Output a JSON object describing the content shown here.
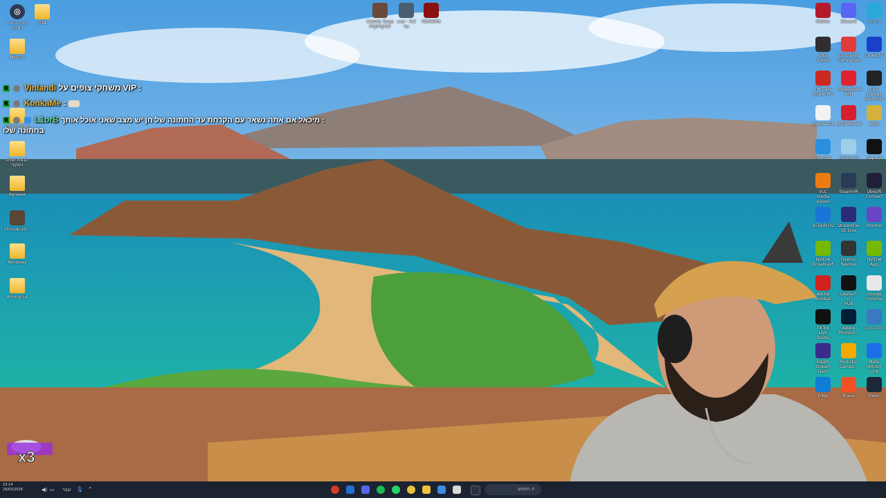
{
  "desktop_left_icons": [
    {
      "label": "קבל פרטים\nו מדוף",
      "icon": "circle-icon"
    },
    {
      "label": "GTA",
      "icon": "folder-icon"
    },
    {
      "label": "PHOTO",
      "icon": "folder-icon"
    },
    {
      "label": "DSWindows",
      "icon": "folder-icon"
    },
    {
      "label": "קבצות שונים\nבשקוף",
      "icon": "folder-icon"
    },
    {
      "label": "Agreeee",
      "icon": "folder-icon"
    },
    {
      "label": "vlcsnap-20...",
      "icon": "image-icon"
    },
    {
      "label": "Windows",
      "icon": "folder-icon"
    },
    {
      "label": "Among Us",
      "icon": "folder-icon"
    }
  ],
  "desktop_top_icons": [
    {
      "label": "Cosmic Soup\nHighlightS",
      "icon": "person-icon"
    },
    {
      "label": "קובץ - fc2\nנוף",
      "icon": "image-icon"
    },
    {
      "label": "REANIMA",
      "icon": "game-icon"
    }
  ],
  "desktop_right_icons": [
    {
      "label": "Roblox",
      "icon": "roblox-icon",
      "color": "#b51a2a"
    },
    {
      "label": "Discord",
      "icon": "discord-icon",
      "color": "#5865f2"
    },
    {
      "label": "וח רוסר",
      "icon": "monitor-icon",
      "color": "#2aa9d8"
    },
    {
      "label": "OBS Studio",
      "icon": "obs-icon",
      "color": "#302e31"
    },
    {
      "label": "Controller\nCompanion",
      "icon": "controller-icon",
      "color": "#e23b3b"
    },
    {
      "label": "CorelySC",
      "icon": "app-icon",
      "color": "#1a40c9"
    },
    {
      "label": "FM Cars\nStreet Pro",
      "icon": "car-icon",
      "color": "#cc2a20"
    },
    {
      "label": "Bitdefender\nVPN",
      "icon": "shield-icon",
      "color": "#e0232f"
    },
    {
      "label": "Epic Games\nLauncher",
      "icon": "epic-icon",
      "color": "#222"
    },
    {
      "label": "Overwatch",
      "icon": "overwatch-icon",
      "color": "#f2f2f2"
    },
    {
      "label": "Bitdefender",
      "icon": "bitdefender-icon",
      "color": "#d4202c"
    },
    {
      "label": "Bully",
      "icon": "bully-icon",
      "color": "#d4b13a"
    },
    {
      "label": "Fortnite",
      "icon": "fortnite-icon",
      "color": "#2b8fe0"
    },
    {
      "label": "סל המיחזור",
      "icon": "recycle-bin-icon",
      "color": "#9ecfe8"
    },
    {
      "label": "CapCut",
      "icon": "capcut-icon",
      "color": "#111"
    },
    {
      "label": "VLC media\nplayer",
      "icon": "vlc-icon",
      "color": "#f07a12"
    },
    {
      "label": "SteamVR",
      "icon": "vr-icon",
      "color": "#2a3b56"
    },
    {
      "label": "Ubisoft\nConnect",
      "icon": "ubisoft-icon",
      "color": "#1f1f3a"
    },
    {
      "label": "3uTools(32...",
      "icon": "tools-icon",
      "color": "#1b75d8"
    },
    {
      "label": "StreamEle...\nSE.Live",
      "icon": "streamelements-icon",
      "color": "#2b2b7a"
    },
    {
      "label": "Stremio",
      "icon": "stremio-icon",
      "color": "#6c45c7"
    },
    {
      "label": "NVIDIA\nBroadcast",
      "icon": "nvidia-icon",
      "color": "#76b900"
    },
    {
      "label": "DaVinci\nResolve",
      "icon": "davinci-icon",
      "color": "#333"
    },
    {
      "label": "NVIDIA App",
      "icon": "nvidia-icon",
      "color": "#76b900"
    },
    {
      "label": "Adobe\nAcrobat",
      "icon": "acrobat-icon",
      "color": "#d0211c"
    },
    {
      "label": "Logitech G\nHUB",
      "icon": "logitech-icon",
      "color": "#111"
    },
    {
      "label": "Google\nChrome",
      "icon": "chrome-icon",
      "color": "#e8e8e8"
    },
    {
      "label": "TikTok LIVE\nStudio",
      "icon": "tiktok-icon",
      "color": "#111"
    },
    {
      "label": "Adobe\nPhotosh...",
      "icon": "photoshop-icon",
      "color": "#001e36"
    },
    {
      "label": "לוח הבקרה",
      "icon": "control-panel-icon",
      "color": "#3a78c2"
    },
    {
      "label": "Elgato\nStream Deck",
      "icon": "streamdeck-icon",
      "color": "#3c2b8a"
    },
    {
      "label": "Rockstar\nGames...",
      "icon": "rockstar-icon",
      "color": "#f2a900"
    },
    {
      "label": "Meta\nHorizon Link",
      "icon": "meta-icon",
      "color": "#1c6fe8"
    },
    {
      "label": "Edge",
      "icon": "edge-icon",
      "color": "#0f7cd8"
    },
    {
      "label": "Brave",
      "icon": "brave-icon",
      "color": "#f25124"
    },
    {
      "label": "Steam",
      "icon": "steam-icon",
      "color": "#1b2838"
    }
  ],
  "chat": [
    {
      "user": "Vinlandi",
      "text": "משחקי צופים על VIP :"
    },
    {
      "user": "KonkaMe",
      "text": ":"
    },
    {
      "user": "L1orB",
      "text": "מיכאל אם אתה נשאר עם הקרחת עד החתונה של חן יש מצב שאני אוכל אותך :",
      "text2": "בחתונה שלו"
    }
  ],
  "combo_text": "x3",
  "taskbar": {
    "time": "23:14",
    "date": "29/03/2026",
    "lang": "עבר",
    "search_placeholder": "חיפוש"
  }
}
